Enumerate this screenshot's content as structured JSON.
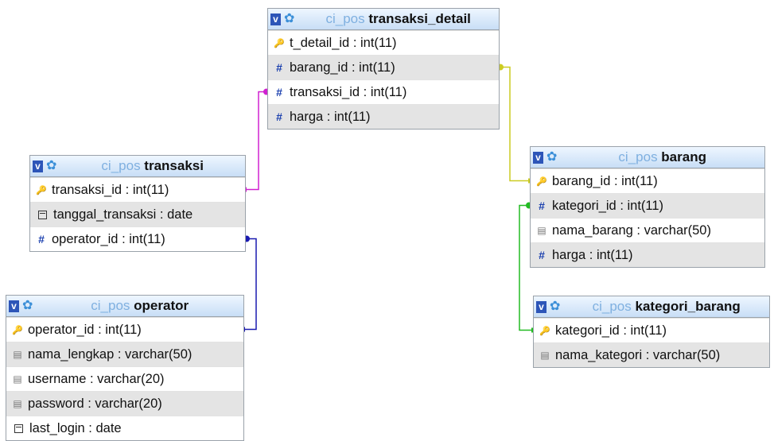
{
  "db_prefix": "ci_pos",
  "tables": [
    {
      "id": "transaksi_detail",
      "name": "transaksi_detail",
      "fields": [
        {
          "name": "t_detail_id",
          "type": "int(11)",
          "icon": "key"
        },
        {
          "name": "barang_id",
          "type": "int(11)",
          "icon": "num"
        },
        {
          "name": "transaksi_id",
          "type": "int(11)",
          "icon": "num"
        },
        {
          "name": "harga",
          "type": "int(11)",
          "icon": "num"
        }
      ]
    },
    {
      "id": "transaksi",
      "name": "transaksi",
      "fields": [
        {
          "name": "transaksi_id",
          "type": "int(11)",
          "icon": "key"
        },
        {
          "name": "tanggal_transaksi",
          "type": "date",
          "icon": "date"
        },
        {
          "name": "operator_id",
          "type": "int(11)",
          "icon": "num"
        }
      ]
    },
    {
      "id": "operator",
      "name": "operator",
      "fields": [
        {
          "name": "operator_id",
          "type": "int(11)",
          "icon": "key"
        },
        {
          "name": "nama_lengkap",
          "type": "varchar(50)",
          "icon": "txt"
        },
        {
          "name": "username",
          "type": "varchar(20)",
          "icon": "txt"
        },
        {
          "name": "password",
          "type": "varchar(20)",
          "icon": "txt"
        },
        {
          "name": "last_login",
          "type": "date",
          "icon": "date"
        }
      ]
    },
    {
      "id": "barang",
      "name": "barang",
      "fields": [
        {
          "name": "barang_id",
          "type": "int(11)",
          "icon": "key"
        },
        {
          "name": "kategori_id",
          "type": "int(11)",
          "icon": "num"
        },
        {
          "name": "nama_barang",
          "type": "varchar(50)",
          "icon": "txt"
        },
        {
          "name": "harga",
          "type": "int(11)",
          "icon": "num"
        }
      ]
    },
    {
      "id": "kategori_barang",
      "name": "kategori_barang",
      "fields": [
        {
          "name": "kategori_id",
          "type": "int(11)",
          "icon": "key"
        },
        {
          "name": "nama_kategori",
          "type": "varchar(50)",
          "icon": "txt"
        }
      ]
    }
  ],
  "relations": [
    {
      "from_table": "transaksi_detail",
      "from_field": "transaksi_id",
      "to_table": "transaksi",
      "to_field": "transaksi_id",
      "color": "#d020d0"
    },
    {
      "from_table": "transaksi_detail",
      "from_field": "barang_id",
      "to_table": "barang",
      "to_field": "barang_id",
      "color": "#cccc22"
    },
    {
      "from_table": "transaksi",
      "from_field": "operator_id",
      "to_table": "operator",
      "to_field": "operator_id",
      "color": "#1a1ab0"
    },
    {
      "from_table": "barang",
      "from_field": "kategori_id",
      "to_table": "kategori_barang",
      "to_field": "kategori_id",
      "color": "#22bb22"
    }
  ],
  "icons": {
    "toggle": "v-icon",
    "settings": "gear-icon",
    "key": "key-icon",
    "num": "hash-icon",
    "txt": "text-field-icon",
    "date": "date-icon"
  }
}
